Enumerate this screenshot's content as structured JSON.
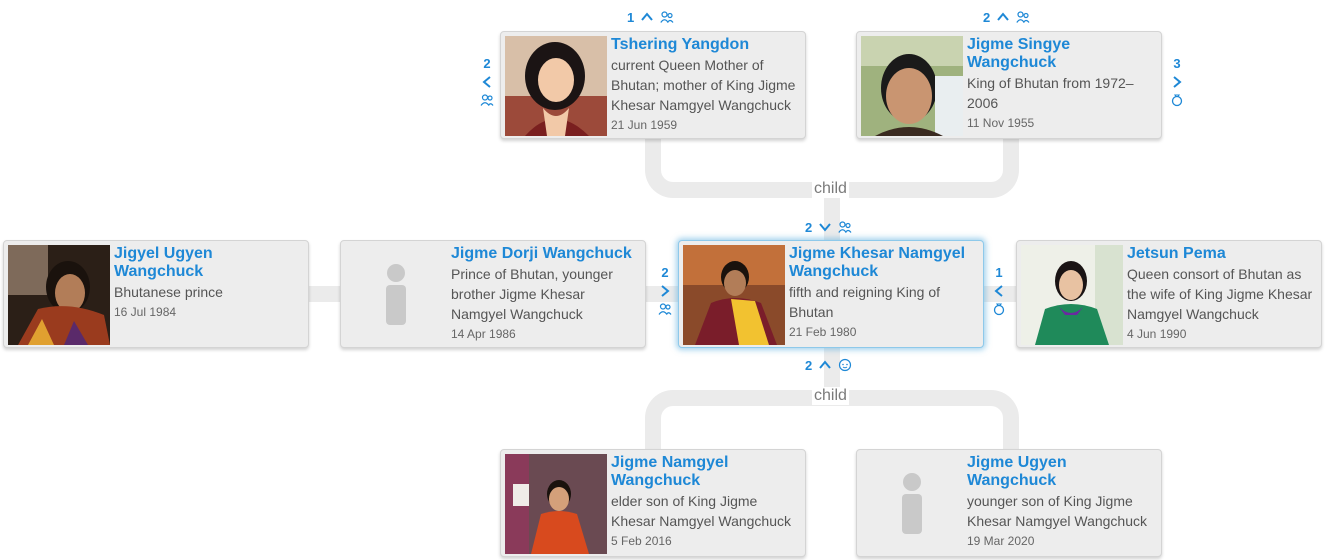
{
  "relations": {
    "child_top": "child",
    "child_bottom": "child"
  },
  "people": {
    "tshering": {
      "name": "Tshering Yangdon",
      "desc": "current Queen Mother of Bhutan; mother of King Jigme Khesar Namgyel Wangchuck",
      "date": "21 Jun 1959",
      "photo": "photo-woman"
    },
    "singye": {
      "name": "Jigme Singye Wangchuck",
      "desc": "King of Bhutan from 1972–2006",
      "date": "11 Nov 1955",
      "photo": "photo-man"
    },
    "jigyel": {
      "name": "Jigyel Ugyen Wangchuck",
      "desc": "Bhutanese prince",
      "date": "16 Jul 1984",
      "photo": "photo-young-man"
    },
    "dorji": {
      "name": "Jigme Dorji Wangchuck",
      "desc": "Prince of Bhutan, younger brother Jigme Khesar Namgyel Wangchuck",
      "date": "14 Apr 1986",
      "photo": "placeholder-person-icon"
    },
    "khesar": {
      "name": "Jigme Khesar Namgyel Wangchuck",
      "desc": "fifth and reigning King of Bhutan",
      "date": "21 Feb 1980",
      "photo": "photo-king"
    },
    "jetsun": {
      "name": "Jetsun Pema",
      "desc": "Queen consort of Bhutan as the wife of King Jigme Khesar Namgyel Wangchuck",
      "date": "4 Jun 1990",
      "photo": "photo-queen"
    },
    "namgyel": {
      "name": "Jigme Namgyel Wangchuck",
      "desc": "elder son of King Jigme Khesar Namgyel Wangchuck",
      "date": "5 Feb 2016",
      "photo": "photo-child"
    },
    "ugyen": {
      "name": "Jigme Ugyen Wangchuck",
      "desc": "younger son of King Jigme Khesar Namgyel Wangchuck",
      "date": "19 Mar 2020",
      "photo": "placeholder-person-icon"
    }
  },
  "nav": {
    "tshering_parents": "1",
    "tshering_siblings": "2",
    "singye_parents": "2",
    "singye_spouses": "3",
    "khesar_parents_collapse": "2",
    "dorji_siblings": "2",
    "jetsun_spouses": "1",
    "khesar_children": "2"
  },
  "colors": {
    "link": "#1e88d6",
    "card_bg": "#ededed",
    "connector": "#ebebeb",
    "focus_glow": "#8ec9ea"
  }
}
